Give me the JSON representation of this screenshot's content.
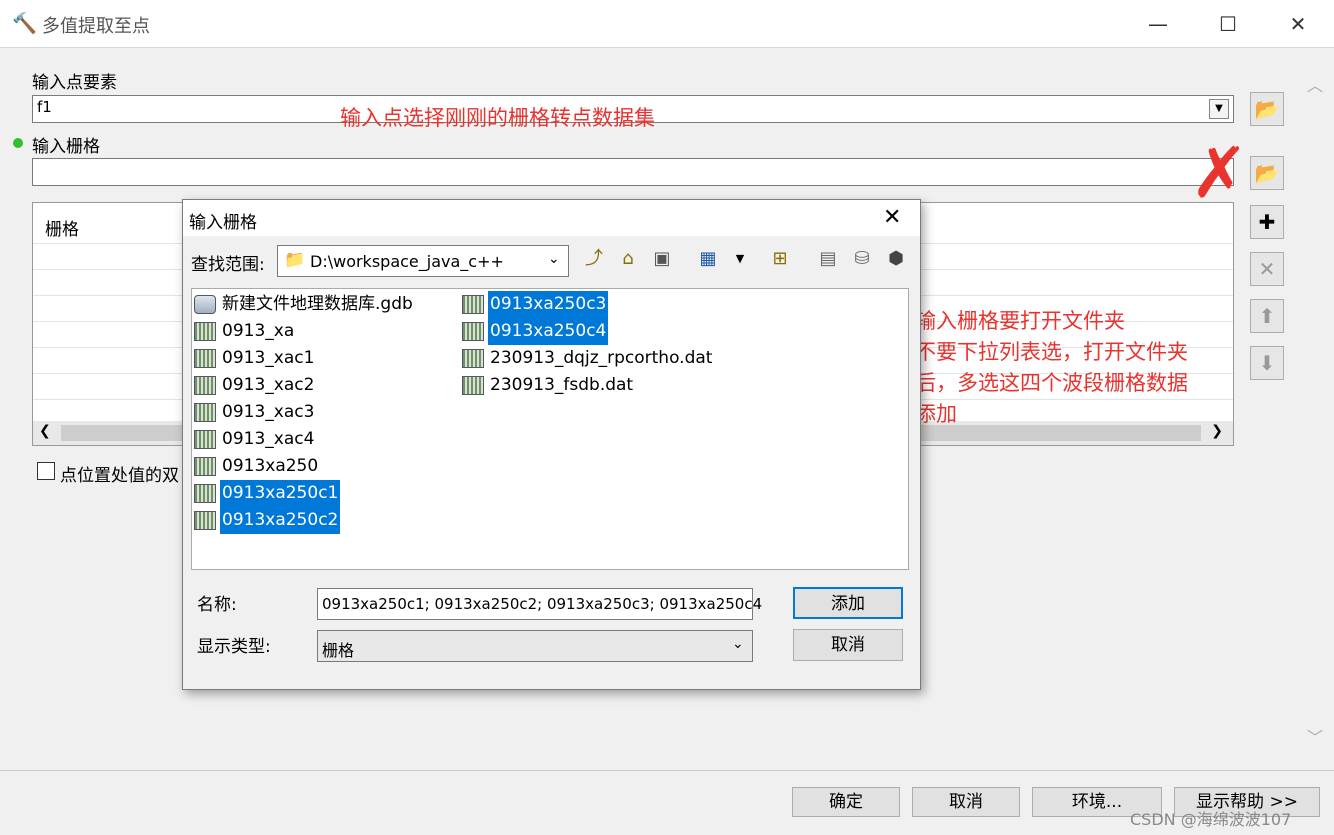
{
  "window": {
    "title": "多值提取至点",
    "minimize_icon": "minimize-icon",
    "maximize_icon": "maximize-icon",
    "close_icon": "close-icon"
  },
  "form": {
    "input_points_label": "输入点要素",
    "input_points_value": "f1",
    "input_rasters_label": "输入栅格",
    "raster_list_header": "栅格",
    "checkbox_label": "点位置处值的双"
  },
  "annotations": {
    "note1": "输入点选择刚刚的栅格转点数据集",
    "note2_lines": [
      "输入栅格要打开文件夹",
      "不要下拉列表选，打开文件夹",
      "后，多选这四个波段栅格数据",
      "添加"
    ]
  },
  "dialog": {
    "title": "输入栅格",
    "lookin_label": "查找范围:",
    "lookin_value": "D:\\workspace_java_c++",
    "files_col1": [
      {
        "name": "新建文件地理数据库.gdb",
        "type": "gdb",
        "selected": false
      },
      {
        "name": "0913_xa",
        "type": "raster",
        "selected": false
      },
      {
        "name": "0913_xac1",
        "type": "raster",
        "selected": false
      },
      {
        "name": "0913_xac2",
        "type": "raster",
        "selected": false
      },
      {
        "name": "0913_xac3",
        "type": "raster",
        "selected": false
      },
      {
        "name": "0913_xac4",
        "type": "raster",
        "selected": false
      },
      {
        "name": "0913xa250",
        "type": "raster",
        "selected": false
      },
      {
        "name": "0913xa250c1",
        "type": "raster",
        "selected": true
      },
      {
        "name": "0913xa250c2",
        "type": "raster",
        "selected": true
      }
    ],
    "files_col2": [
      {
        "name": "0913xa250c3",
        "type": "raster",
        "selected": true
      },
      {
        "name": "0913xa250c4",
        "type": "raster",
        "selected": true
      },
      {
        "name": "230913_dqjz_rpcortho.dat",
        "type": "raster",
        "selected": false
      },
      {
        "name": "230913_fsdb.dat",
        "type": "raster",
        "selected": false
      }
    ],
    "name_label": "名称:",
    "name_value": "0913xa250c1; 0913xa250c2; 0913xa250c3; 0913xa250c4",
    "type_label": "显示类型:",
    "type_value": "栅格",
    "add_button": "添加",
    "cancel_button": "取消"
  },
  "bottom": {
    "ok": "确定",
    "cancel": "取消",
    "env": "环境...",
    "help": "显示帮助 >>"
  },
  "watermark": "CSDN @海绵波波107",
  "colors": {
    "selection": "#0078d7",
    "annotation": "#e8332f",
    "dot": "#2fbf2f"
  }
}
